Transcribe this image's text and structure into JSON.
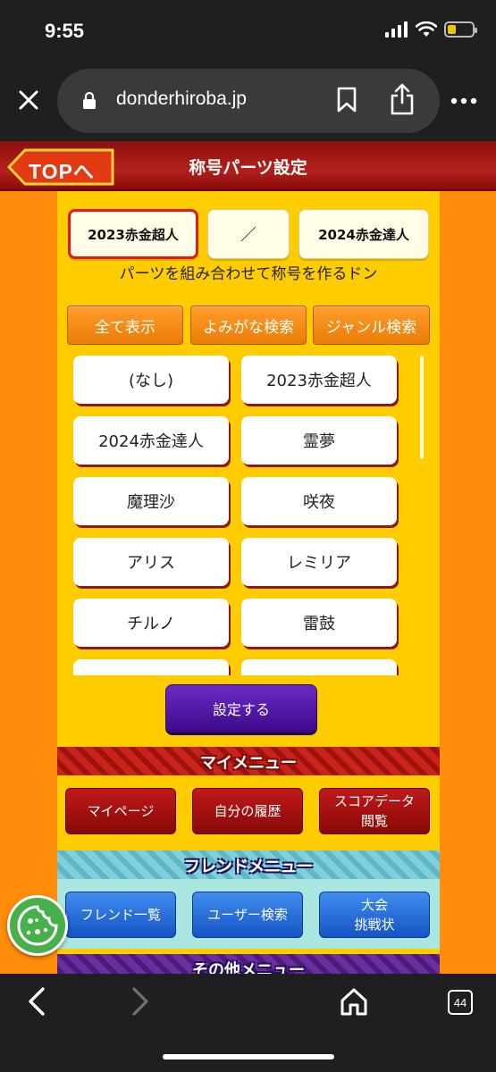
{
  "status_bar": {
    "time": "9:55",
    "battery_level": 0.35
  },
  "browser": {
    "url": "donderhiroba.jp",
    "tab_count": "44"
  },
  "page": {
    "top_button": "TOPへ",
    "title": "称号パーツ設定",
    "selected_title": {
      "first": "2023赤金超人",
      "separator": "／",
      "second": "2024赤金達人"
    },
    "instruction": "パーツを組み合わせて称号を作るドン",
    "filters": [
      "全て表示",
      "よみがな検索",
      "ジャンル検索"
    ],
    "parts": [
      "(なし)",
      "2023赤金超人",
      "2024赤金達人",
      "霊夢",
      "魔理沙",
      "咲夜",
      "アリス",
      "レミリア",
      "チルノ",
      "雷鼓",
      "",
      ""
    ],
    "submit_label": "設定する",
    "my_menu": {
      "heading": "マイメニュー",
      "items": [
        "マイページ",
        "自分の履歴",
        "スコアデータ\n閲覧"
      ]
    },
    "friend_menu": {
      "heading": "フレンドメニュー",
      "items": [
        "フレンド一覧",
        "ユーザー検索",
        "大会\n挑戦状"
      ]
    },
    "other_menu": {
      "heading": "その他メニュー"
    }
  },
  "colors": {
    "page_bg": "#ff8c0a",
    "content_bg": "#ffcc00",
    "header_red": "#b3201b",
    "selected_border": "#e01919",
    "submit_purple": "#4f1aa6",
    "menu_red": "#a51010",
    "menu_blue": "#2b6fde"
  }
}
